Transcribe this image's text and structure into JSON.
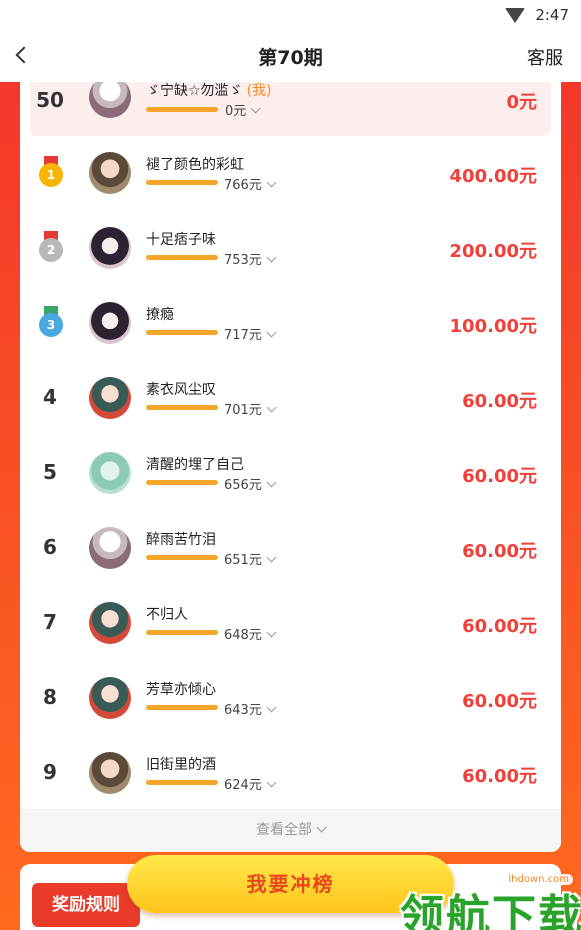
{
  "status_bar": {
    "time": "2:47"
  },
  "nav": {
    "title": "第70期",
    "service": "客服"
  },
  "my_entry": {
    "rank": "50",
    "name": "ゞ宁缺☆勿滥ゞ",
    "tag": "(我)",
    "amount": "0元",
    "prize": "0元"
  },
  "leaderboard": [
    {
      "rank": "1",
      "name": "褪了颜色的彩虹",
      "amount": "766元",
      "prize": "400.00元"
    },
    {
      "rank": "2",
      "name": "十足痞子味",
      "amount": "753元",
      "prize": "200.00元"
    },
    {
      "rank": "3",
      "name": "撩瘾",
      "amount": "717元",
      "prize": "100.00元"
    },
    {
      "rank": "4",
      "name": "素衣风尘叹",
      "amount": "701元",
      "prize": "60.00元"
    },
    {
      "rank": "5",
      "name": "清醒的埋了自己",
      "amount": "656元",
      "prize": "60.00元"
    },
    {
      "rank": "6",
      "name": "醉雨苦竹泪",
      "amount": "651元",
      "prize": "60.00元"
    },
    {
      "rank": "7",
      "name": "不归人",
      "amount": "648元",
      "prize": "60.00元"
    },
    {
      "rank": "8",
      "name": "芳草亦倾心",
      "amount": "643元",
      "prize": "60.00元"
    },
    {
      "rank": "9",
      "name": "旧街里的酒",
      "amount": "624元",
      "prize": "60.00元"
    }
  ],
  "view_all": "查看全部",
  "rules_button": "奖励规则",
  "cta_button": "我要冲榜",
  "watermark": {
    "text": "领航下载",
    "domain": "lhdown.com"
  },
  "colors": {
    "accent_red": "#f0403a",
    "progress": "#f4a62a",
    "gold": "#f7b500",
    "silver": "#b8b8b8",
    "bronze_blue": "#4aa8e0"
  },
  "icons": [
    "wifi-icon",
    "back-arrow-icon",
    "chevron-down-icon",
    "gold-medal-icon",
    "silver-medal-icon",
    "bronze-medal-icon"
  ]
}
